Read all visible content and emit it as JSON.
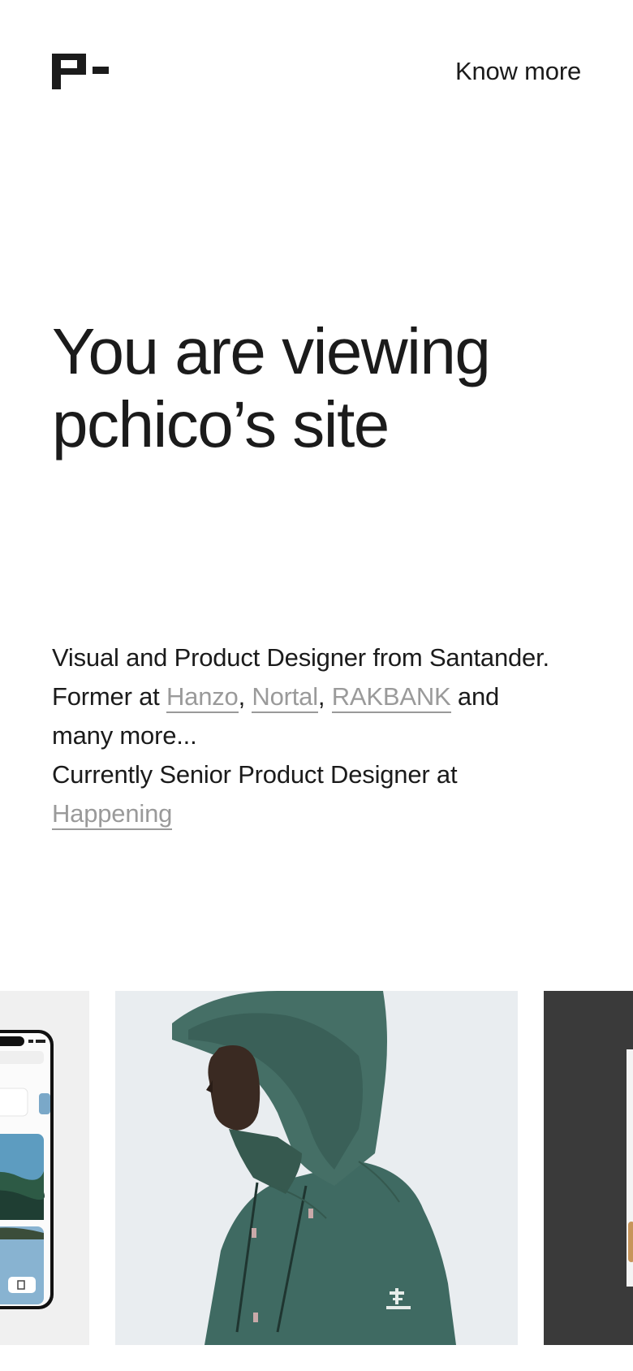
{
  "header": {
    "logo_alt": "P-",
    "nav_link": "Know more"
  },
  "hero": {
    "line1": "You are viewing",
    "line2": "pchico’s site"
  },
  "bio": {
    "line1": "Visual and Product Designer from Santander.",
    "former_prefix": "Former at ",
    "companies": [
      "Hanzo",
      "Nortal",
      "RAKBANK"
    ],
    "separator": ", ",
    "former_suffix": " and",
    "line3": "many more...",
    "current_prefix": "Currently Senior Product Designer at",
    "current_company": "Happening"
  },
  "gallery": {
    "cards": [
      {
        "name": "project-card-mobile-app",
        "bg": "#f0f0f0"
      },
      {
        "name": "project-card-jacket-photo",
        "bg": "#e9edf0"
      },
      {
        "name": "project-card-dark",
        "bg": "#3a3a3a"
      }
    ]
  },
  "colors": {
    "text": "#1b1b1b",
    "link_muted": "#9a9a9a",
    "jacket": "#3f6a62"
  }
}
